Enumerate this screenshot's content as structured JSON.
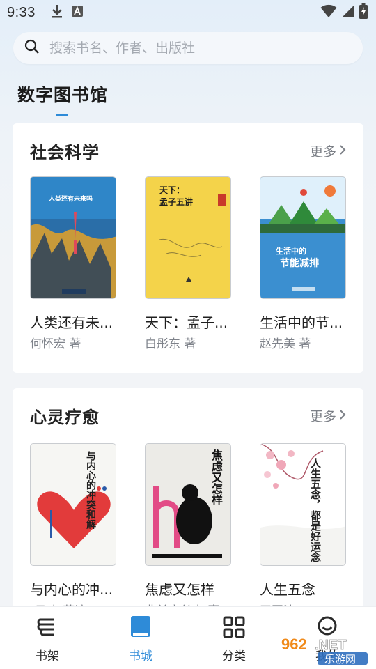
{
  "status_bar": {
    "time": "9:33",
    "left_icons": [
      "download-icon",
      "app-notification-icon"
    ],
    "right_icons": [
      "wifi-icon",
      "signal-icon",
      "battery-charging-icon"
    ]
  },
  "search": {
    "placeholder": "搜索书名、作者、出版社",
    "value": ""
  },
  "page_title": "数字图书馆",
  "colors": {
    "accent": "#2e8bd8",
    "card_bg": "#ffffff",
    "muted_text": "#7e828a"
  },
  "sections": [
    {
      "title": "社会科学",
      "more_label": "更多",
      "books": [
        {
          "title": "人类还有未...",
          "author": "何怀宏 著",
          "cover_text": "人类还有未来吗"
        },
        {
          "title": "天下：孟子...",
          "author": "白彤东 著",
          "cover_text": "天下：\n孟子五讲"
        },
        {
          "title": "生活中的节...",
          "author": "赵先美 著",
          "cover_text_top": "生活中的",
          "cover_text_bottom": "节能减排"
        }
      ]
    },
    {
      "title": "心灵疗愈",
      "more_label": "更多",
      "books": [
        {
          "title": "与内心的冲...",
          "author": "[日]加藤谛三...",
          "cover_text": "与内心的冲突和解"
        },
        {
          "title": "焦虑又怎样",
          "author": "弗兰齐丝卡·赛...",
          "cover_text": "焦虑又怎样"
        },
        {
          "title": "人生五念",
          "author": "王国涛",
          "cover_text": "人生五念，都是好运念"
        }
      ]
    }
  ],
  "nav": {
    "items": [
      {
        "label": "书架",
        "icon": "bookshelf-icon",
        "active": false
      },
      {
        "label": "书城",
        "icon": "book-icon",
        "active": true
      },
      {
        "label": "分类",
        "icon": "grid-icon",
        "active": false
      },
      {
        "label": "我的",
        "icon": "profile-icon",
        "active": false
      }
    ]
  },
  "watermark": {
    "brand": "962.NET",
    "subtitle": "乐游网"
  }
}
